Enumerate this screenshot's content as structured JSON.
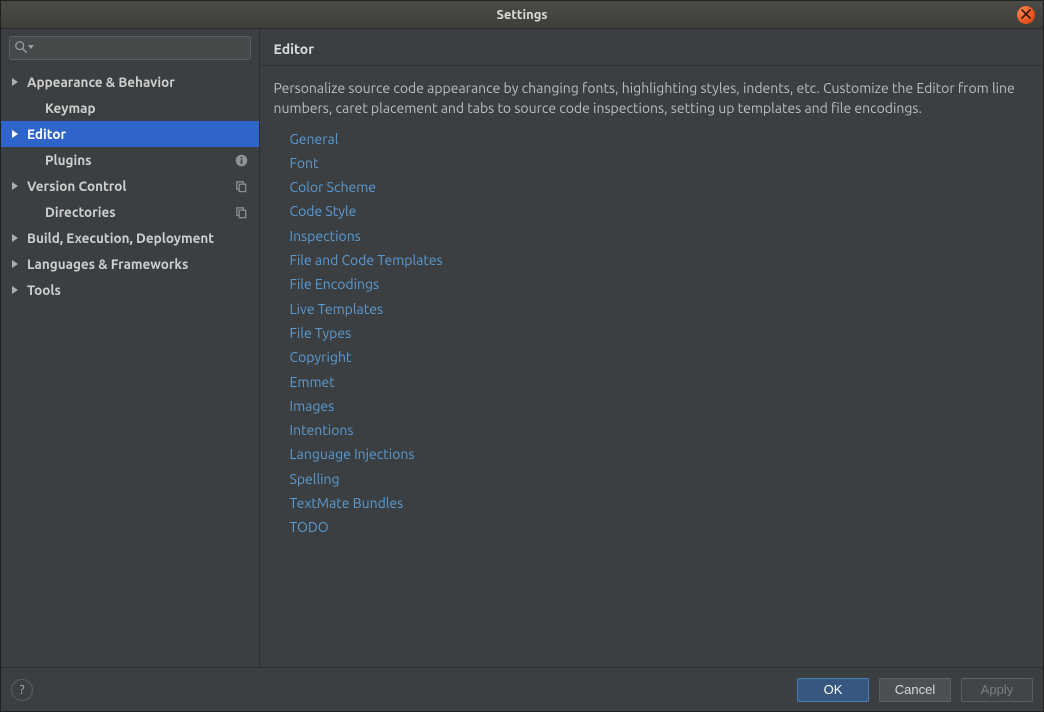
{
  "window": {
    "title": "Settings"
  },
  "search": {
    "placeholder": ""
  },
  "tree": [
    {
      "label": "Appearance & Behavior",
      "expandable": true,
      "level": 0
    },
    {
      "label": "Keymap",
      "expandable": false,
      "level": 1,
      "child": true
    },
    {
      "label": "Editor",
      "expandable": true,
      "level": 0,
      "selected": true
    },
    {
      "label": "Plugins",
      "expandable": false,
      "level": 1,
      "child": true,
      "trail": "info"
    },
    {
      "label": "Version Control",
      "expandable": true,
      "level": 0,
      "trail": "copy"
    },
    {
      "label": "Directories",
      "expandable": false,
      "level": 1,
      "child": true,
      "trail": "copy"
    },
    {
      "label": "Build, Execution, Deployment",
      "expandable": true,
      "level": 0
    },
    {
      "label": "Languages & Frameworks",
      "expandable": true,
      "level": 0
    },
    {
      "label": "Tools",
      "expandable": true,
      "level": 0
    }
  ],
  "pane": {
    "title": "Editor",
    "description": "Personalize source code appearance by changing fonts, highlighting styles, indents, etc. Customize the Editor from line numbers, caret placement and tabs to source code inspections, setting up templates and file encodings.",
    "links": [
      "General",
      "Font",
      "Color Scheme",
      "Code Style",
      "Inspections",
      "File and Code Templates",
      "File Encodings",
      "Live Templates",
      "File Types",
      "Copyright",
      "Emmet",
      "Images",
      "Intentions",
      "Language Injections",
      "Spelling",
      "TextMate Bundles",
      "TODO"
    ]
  },
  "footer": {
    "help": "?",
    "ok": "OK",
    "cancel": "Cancel",
    "apply": "Apply"
  }
}
